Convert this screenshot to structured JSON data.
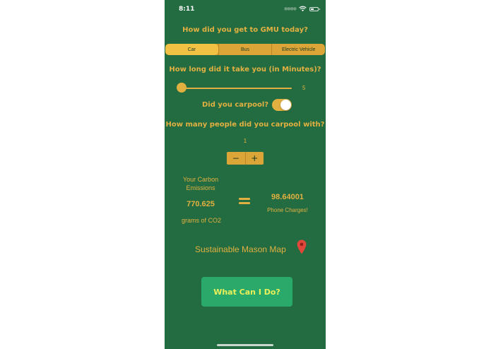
{
  "status_bar": {
    "time": "8:11"
  },
  "questions": {
    "transport": "How did you get to GMU today?",
    "duration": "How long did it take you (in Minutes)?",
    "carpool": "Did you carpool?",
    "carpool_count": "How many people did you carpool with?"
  },
  "transport_options": {
    "selected": "Car",
    "items": [
      "Car",
      "Bus",
      "Electric Vehicle"
    ]
  },
  "duration_slider": {
    "value": "5",
    "fraction": 0.0
  },
  "carpool_toggle": {
    "on": true
  },
  "carpool_stepper": {
    "value": "1",
    "minus_label": "−",
    "plus_label": "+"
  },
  "emissions": {
    "label": "Your Carbon Emissions",
    "value": "770.625",
    "unit": "grams of CO2"
  },
  "equivalent": {
    "value": "98.64001",
    "label": "Phone Charges!"
  },
  "map_link": {
    "label": "Sustainable Mason Map"
  },
  "action_button": {
    "label": "What Can I Do?"
  },
  "colors": {
    "background": "#236c42",
    "accent": "#e2b040",
    "button": "#2aaa6a",
    "button_text": "#eaf05a",
    "pin": "#e0463a"
  },
  "icons": {
    "map": "map-pin-icon",
    "wifi": "wifi-icon",
    "battery": "battery-icon"
  }
}
